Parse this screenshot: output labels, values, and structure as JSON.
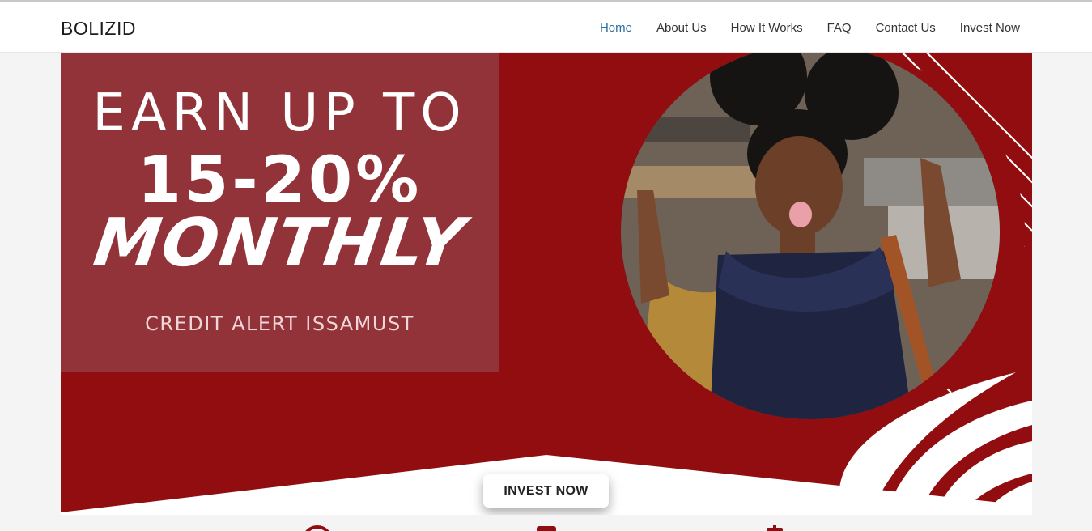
{
  "brand": {
    "name": "BOLIZID"
  },
  "nav": {
    "items": [
      {
        "label": "Home",
        "active": true
      },
      {
        "label": "About Us"
      },
      {
        "label": "How It Works"
      },
      {
        "label": "FAQ"
      },
      {
        "label": "Contact Us"
      },
      {
        "label": "Invest Now"
      }
    ]
  },
  "hero": {
    "line1": "EARN UP TO",
    "line2": "15-20%",
    "line3": "MONTHLY",
    "tagline": "CREDIT ALERT ISSAMUST",
    "cta_label": "INVEST NOW"
  },
  "colors": {
    "hero_red": "#910d0f",
    "panel_red": "#923339",
    "nav_active": "#2a6d9e",
    "white": "#ffffff"
  },
  "icons": [
    "target-icon",
    "phone-icon",
    "dollar-icon"
  ]
}
